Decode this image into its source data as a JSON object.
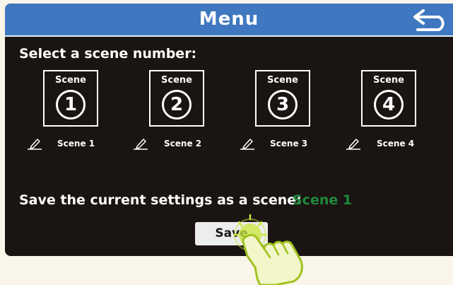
{
  "header": {
    "title": "Menu",
    "back_icon": "back-arrow-icon",
    "color": "#3f78c1"
  },
  "select": {
    "heading": "Select a scene number:",
    "scenes": [
      {
        "box_label": "Scene",
        "number": "1",
        "name": "Scene 1"
      },
      {
        "box_label": "Scene",
        "number": "2",
        "name": "Scene 2"
      },
      {
        "box_label": "Scene",
        "number": "3",
        "name": "Scene 3"
      },
      {
        "box_label": "Scene",
        "number": "4",
        "name": "Scene 4"
      }
    ]
  },
  "save": {
    "text": "Save the current settings as a scene:",
    "selected_scene": "Scene 1",
    "selected_color": "#1f8a3a",
    "button_label": "Save"
  },
  "overlay": {
    "icon": "tap-hand-icon",
    "color": "#c8e63a"
  }
}
